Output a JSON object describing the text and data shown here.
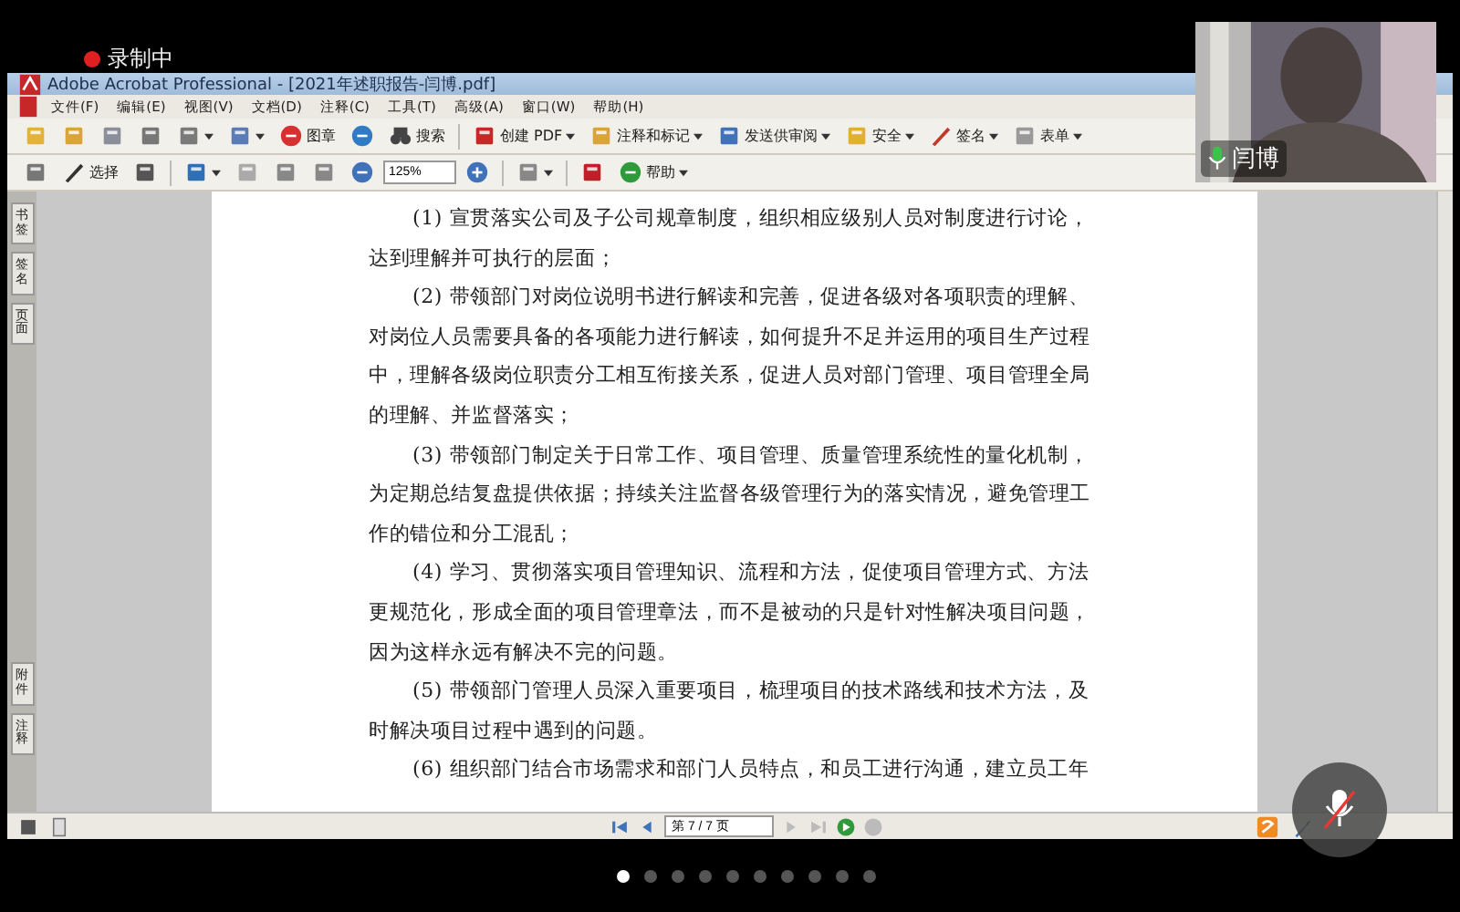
{
  "recording": {
    "label": "录制中"
  },
  "window": {
    "title": "Adobe Acrobat Professional - [2021年述职报告-闫博.pdf]"
  },
  "menu": [
    "文件(F)",
    "编辑(E)",
    "视图(V)",
    "文档(D)",
    "注释(C)",
    "工具(T)",
    "高级(A)",
    "窗口(W)",
    "帮助(H)"
  ],
  "toolbar": [
    {
      "kind": "icon",
      "dropdown": false
    },
    {
      "kind": "icon",
      "dropdown": false
    },
    {
      "kind": "icon",
      "dropdown": false
    },
    {
      "kind": "icon",
      "dropdown": false
    },
    {
      "kind": "icon",
      "dropdown": true
    },
    {
      "kind": "icon",
      "dropdown": true
    },
    {
      "kind": "button",
      "label": "图章",
      "dropdown": false
    },
    {
      "kind": "icon",
      "dropdown": false
    },
    {
      "kind": "button",
      "label": "搜索",
      "dropdown": false
    },
    {
      "kind": "sep"
    },
    {
      "kind": "button",
      "label": "创建 PDF",
      "dropdown": true
    },
    {
      "kind": "button",
      "label": "注释和标记",
      "dropdown": true
    },
    {
      "kind": "button",
      "label": "发送供审阅",
      "dropdown": true
    },
    {
      "kind": "button",
      "label": "安全",
      "dropdown": true
    },
    {
      "kind": "button",
      "label": "签名",
      "dropdown": true
    },
    {
      "kind": "button",
      "label": "表单",
      "dropdown": true
    }
  ],
  "toolbar2": [
    {
      "kind": "icon",
      "dropdown": false
    },
    {
      "kind": "button",
      "label": "选择",
      "dropdown": false
    },
    {
      "kind": "icon",
      "dropdown": false
    },
    {
      "kind": "sep"
    },
    {
      "kind": "icon",
      "dropdown": true
    },
    {
      "kind": "icon",
      "dropdown": false
    },
    {
      "kind": "icon",
      "dropdown": false
    },
    {
      "kind": "icon",
      "dropdown": false
    },
    {
      "kind": "icon",
      "dropdown": false
    },
    {
      "kind": "field",
      "value": "125%"
    },
    {
      "kind": "icon",
      "dropdown": false
    },
    {
      "kind": "sep"
    },
    {
      "kind": "icon",
      "dropdown": true
    },
    {
      "kind": "sep"
    },
    {
      "kind": "icon",
      "dropdown": false
    },
    {
      "kind": "button",
      "label": "帮助",
      "dropdown": true
    }
  ],
  "side_tabs": [
    {
      "label": "书签",
      "selected": false
    },
    {
      "label": "签名",
      "selected": false
    },
    {
      "label": "页面",
      "selected": false
    },
    {
      "label": "附件",
      "selected": false
    },
    {
      "label": "注释",
      "selected": false
    }
  ],
  "paragraphs": [
    {
      "lines": [
        "(1) 宣贯落实公司及子公司规章制度，组织相应级别人员对制度进行讨论，",
        "达到理解并可执行的层面；"
      ]
    },
    {
      "lines": [
        "(2) 带领部门对岗位说明书进行解读和完善，促进各级对各项职责的理解、",
        "对岗位人员需要具备的各项能力进行解读，如何提升不足并运用的项目生产过程",
        "中，理解各级岗位职责分工相互衔接关系，促进人员对部门管理、项目管理全局",
        "的理解、并监督落实；"
      ]
    },
    {
      "lines": [
        "(3) 带领部门制定关于日常工作、项目管理、质量管理系统性的量化机制，",
        "为定期总结复盘提供依据；持续关注监督各级管理行为的落实情况，避免管理工",
        "作的错位和分工混乱；"
      ]
    },
    {
      "lines": [
        "(4) 学习、贯彻落实项目管理知识、流程和方法，促使项目管理方式、方法",
        "更规范化，形成全面的项目管理章法，而不是被动的只是针对性解决项目问题，",
        "因为这样永远有解决不完的问题。"
      ]
    },
    {
      "lines": [
        "(5) 带领部门管理人员深入重要项目，梳理项目的技术路线和技术方法，及",
        "时解决项目过程中遇到的问题。"
      ]
    },
    {
      "lines": [
        "(6) 组织部门结合市场需求和部门人员特点，和员工进行沟通，建立员工年"
      ]
    }
  ],
  "status_bar": {
    "page": "第 7 / 7 页"
  },
  "video": {
    "name": "闫博"
  },
  "mic": {
    "muted": true
  },
  "dots": [
    {
      "selected": true
    },
    {
      "selected": false
    },
    {
      "selected": false
    },
    {
      "selected": false
    },
    {
      "selected": false
    },
    {
      "selected": false
    },
    {
      "selected": false
    },
    {
      "selected": false
    },
    {
      "selected": false
    },
    {
      "selected": false
    }
  ]
}
